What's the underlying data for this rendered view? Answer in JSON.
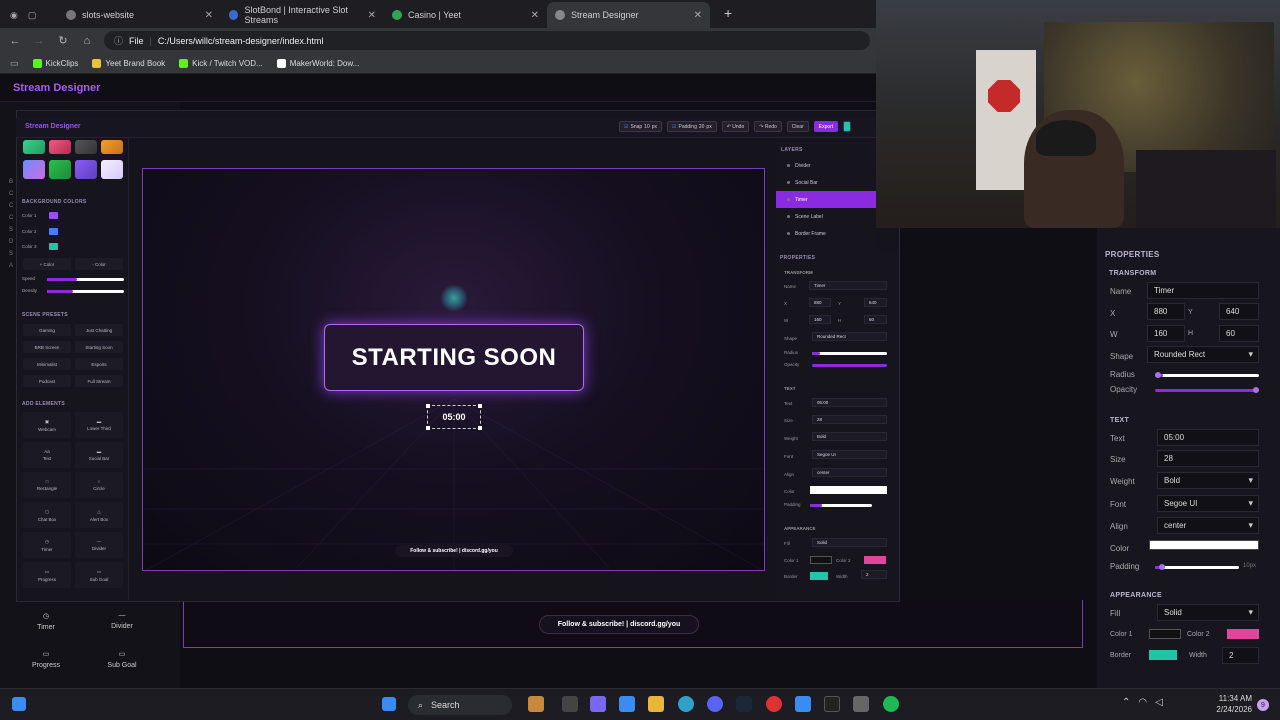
{
  "browser": {
    "tabs": [
      {
        "label": "slots-website",
        "active": false
      },
      {
        "label": "SlotBond | Interactive Slot Streams",
        "active": false
      },
      {
        "label": "Casino | Yeet",
        "active": false
      },
      {
        "label": "Stream Designer",
        "active": true
      }
    ],
    "address_prefix": "File",
    "address": "C:/Users/willc/stream-designer/index.html",
    "bookmarks": [
      "KickClips",
      "Yeet Brand Book",
      "Kick / Twitch VOD...",
      "MakerWorld: Dow..."
    ]
  },
  "app": {
    "title": "Stream Designer",
    "inner_title": "Stream Designer",
    "toolbar": {
      "snap_label": "Snap",
      "snap_value": "10",
      "padding_label": "Padding",
      "padding_value": "20",
      "unit": "px",
      "undo": "↶ Undo",
      "redo": "↷ Redo",
      "clear": "Clear",
      "export": "Export"
    },
    "left": {
      "bg_colors_title": "BACKGROUND COLORS",
      "colors": [
        {
          "label": "Color 1",
          "hex": "#9b4dee"
        },
        {
          "label": "Color 2",
          "hex": "#3b82f6"
        },
        {
          "label": "Color 3",
          "hex": "#22c3a6"
        }
      ],
      "add_color": "+ Color",
      "remove_color": "- Color",
      "speed_label": "Speed",
      "density_label": "Density",
      "presets_title": "SCENE PRESETS",
      "presets": [
        "Gaming",
        "Just Chatting",
        "BRB Screen",
        "Starting Soon",
        "Minimalist",
        "Esports",
        "Podcast",
        "Full Stream"
      ],
      "elements_title": "ADD ELEMENTS",
      "elements": [
        "Webcam",
        "Lower Third",
        "Text",
        "Social Bar",
        "Rectangle",
        "Circle",
        "Chat Box",
        "Alert Box",
        "Timer",
        "Divider",
        "Progress",
        "Sub Goal"
      ]
    },
    "canvas": {
      "banner_text": "STARTING SOON",
      "timer_text": "05:00",
      "social_text": "Follow & subscribe!  |  discord.gg/you"
    },
    "layers": {
      "title": "LAYERS",
      "items": [
        "Divider",
        "Social Bar",
        "Timer",
        "Scene Label",
        "Border Frame"
      ],
      "selected": "Timer"
    },
    "properties": {
      "title": "PROPERTIES",
      "transform_title": "TRANSFORM",
      "name_label": "Name",
      "name": "Timer",
      "x_label": "X",
      "x": "880",
      "y_label": "Y",
      "y": "640",
      "w_label": "W",
      "w": "160",
      "h_label": "H",
      "h": "60",
      "shape_label": "Shape",
      "shape": "Rounded Rect",
      "radius_label": "Radius",
      "opacity_label": "Opacity",
      "text_title": "TEXT",
      "text_label": "Text",
      "text": "05:00",
      "size_label": "Size",
      "size": "28",
      "weight_label": "Weight",
      "weight": "Bold",
      "font_label": "Font",
      "font": "Segoe UI",
      "align_label": "Align",
      "align": "center",
      "color_label": "Color",
      "padding_label": "Padding",
      "padding_unit": "10px",
      "appearance_title": "APPEARANCE",
      "fill_label": "Fill",
      "fill": "Solid",
      "color1_label": "Color 1",
      "color2_label": "Color 2",
      "border_label": "Border",
      "width_label": "Width",
      "width": "2"
    },
    "bottom": {
      "tiles": [
        "Timer",
        "Divider",
        "Progress",
        "Sub Goal"
      ],
      "social_text": "Follow & subscribe!  |  discord.gg/you"
    }
  },
  "taskbar": {
    "search": "Search",
    "time": "11:34 AM",
    "date": "2/24/2026",
    "badge": "9"
  }
}
